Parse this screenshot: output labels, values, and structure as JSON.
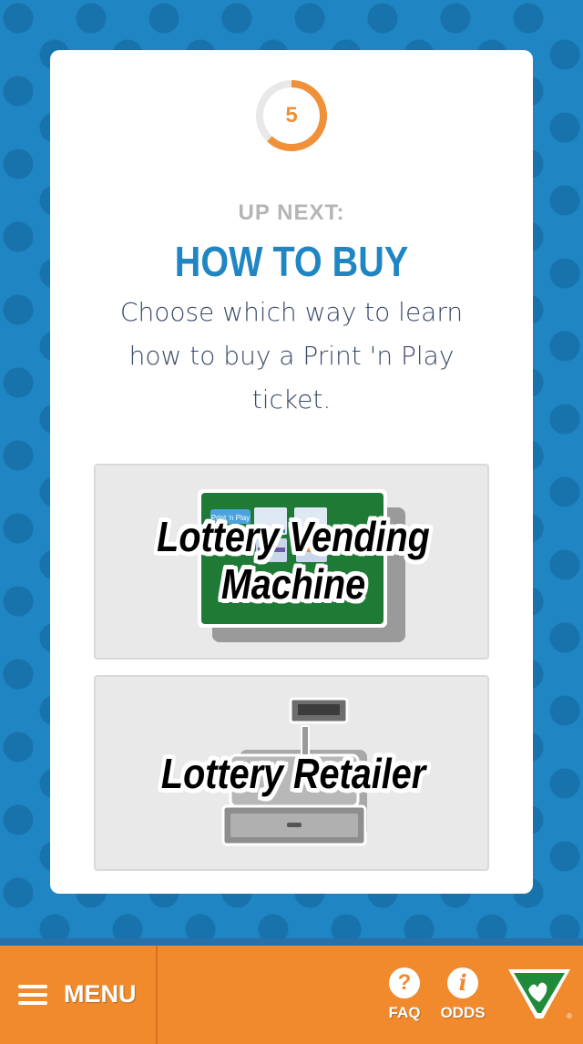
{
  "countdown": {
    "value": "5",
    "progress": 0.62
  },
  "card": {
    "up_next": "UP NEXT:",
    "title": "HOW TO BUY",
    "description": "Choose which way to learn how to buy a Print 'n Play ticket."
  },
  "options": [
    {
      "label_line1": "Lottery Vending",
      "label_line2": "Machine",
      "screen_tag": "Print 'n Play"
    },
    {
      "label": "Lottery Retailer"
    }
  ],
  "bottom_bar": {
    "menu_label": "MENU",
    "faq_label": "FAQ",
    "odds_label": "ODDS",
    "faq_icon": "?",
    "odds_icon": "i"
  },
  "colors": {
    "accent_blue": "#1f86c3",
    "accent_orange": "#f08a2d",
    "vending_green": "#1f7a35"
  },
  "icons": [
    "hamburger-icon",
    "question-circle-icon",
    "info-circle-icon",
    "lottery-logo-icon",
    "vending-machine-icon",
    "cash-register-icon"
  ]
}
